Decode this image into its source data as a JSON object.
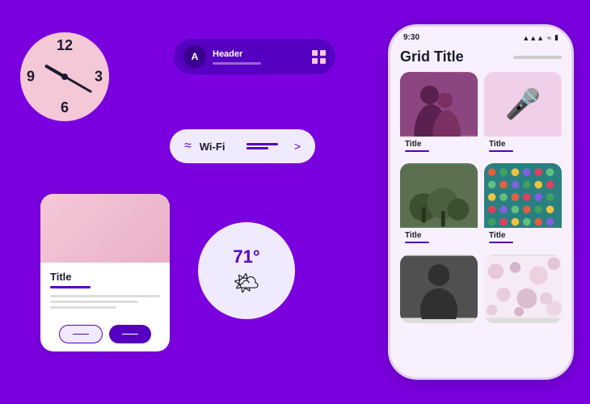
{
  "background_color": "#7B00E0",
  "clock": {
    "numbers": [
      "12",
      "3",
      "6",
      "9"
    ],
    "label": "analog-clock"
  },
  "header_component": {
    "avatar_letter": "A",
    "title": "Header",
    "subtitle_placeholder": ""
  },
  "wifi_component": {
    "label": "Wi-Fi",
    "chevron": ">"
  },
  "card_component": {
    "title": "Title",
    "button1": "——",
    "button2": "——"
  },
  "weather_component": {
    "temperature": "71°",
    "icon": "🌤"
  },
  "phone": {
    "status_bar": {
      "time": "9:30",
      "signal": "▲▲▲",
      "wifi": "▲",
      "battery": "▮"
    },
    "grid_title": "Grid Title",
    "grid_items": [
      {
        "title": "Title",
        "type": "silhouette"
      },
      {
        "title": "Title",
        "type": "microphone"
      },
      {
        "title": "Title",
        "type": "plants"
      },
      {
        "title": "Title",
        "type": "dots"
      },
      {
        "title": "",
        "type": "dark"
      },
      {
        "title": "",
        "type": "circles"
      }
    ]
  }
}
